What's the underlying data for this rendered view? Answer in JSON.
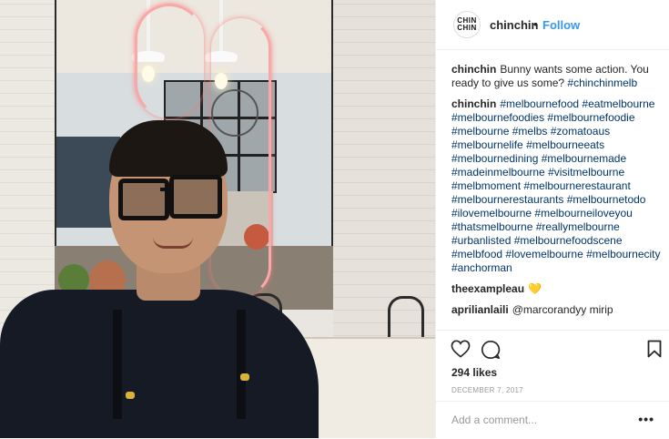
{
  "post": {
    "author": "chinchin",
    "logo_lines": [
      "CHIN",
      "CHIN"
    ],
    "follow_label": "Follow",
    "separator": "•"
  },
  "comments": [
    {
      "username": "chinchin",
      "text": "Bunny wants some action. You ready to give us some?",
      "tags": [
        "#chinchinmelb"
      ]
    },
    {
      "username": "chinchin",
      "text": "",
      "tags": [
        "#melbournefood",
        "#eatmelbourne",
        "#melbournefoodies",
        "#melbournefoodie",
        "#melbourne",
        "#melbs",
        "#zomatoaus",
        "#melbournelife",
        "#melbourneeats",
        "#melbournedining",
        "#melbournemade",
        "#madeinmelbourne",
        "#visitmelbourne",
        "#melbmoment",
        "#melbournerestaurant",
        "#melbournerestaurants",
        "#melbournetodo",
        "#ilovemelbourne",
        "#melbourneiloveyou",
        "#thatsmelbourne",
        "#reallymelbourne",
        "#urbanlisted",
        "#melbournefoodscene",
        "#melbfood",
        "#lovemelbourne",
        "#melbournecity",
        "#anchorman"
      ]
    },
    {
      "username": "theexampleau",
      "text": "💛",
      "tags": []
    },
    {
      "username": "aprilianlaili",
      "text": "@marcorandyy mirip",
      "tags": []
    }
  ],
  "actions": {
    "like_icon": "heart-icon",
    "comment_icon": "comment-icon",
    "save_icon": "bookmark-icon"
  },
  "likes_text": "294 likes",
  "date_text": "DECEMBER 7, 2017",
  "add_comment_placeholder": "Add a comment...",
  "more_label": "•••",
  "colors": {
    "link": "#003569",
    "follow": "#3897f0",
    "text": "#262626",
    "muted": "#999999"
  }
}
